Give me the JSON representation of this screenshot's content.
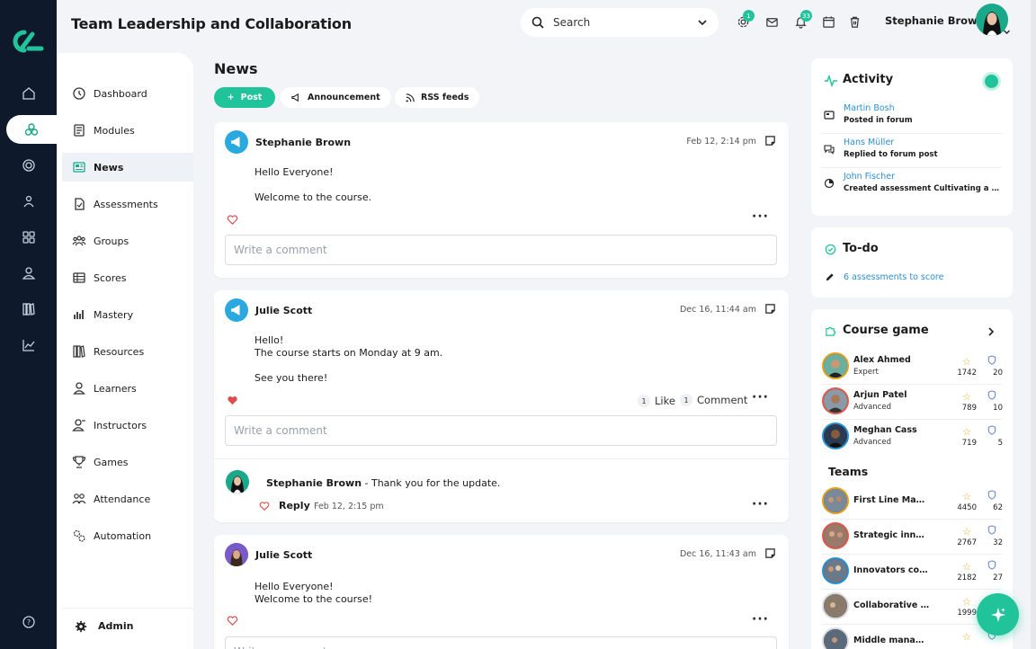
{
  "header": {
    "title": "Team Leadership and Collaboration",
    "search_placeholder": "Search",
    "settings_badge": "1",
    "notifications_badge": "33",
    "user_name": "Stephanie Brown"
  },
  "sidebar": {
    "items": [
      {
        "label": "Dashboard",
        "icon": "dashboard-icon"
      },
      {
        "label": "Modules",
        "icon": "modules-icon"
      },
      {
        "label": "News",
        "icon": "news-icon",
        "active": true
      },
      {
        "label": "Assessments",
        "icon": "assessments-icon"
      },
      {
        "label": "Groups",
        "icon": "groups-icon"
      },
      {
        "label": "Scores",
        "icon": "scores-icon"
      },
      {
        "label": "Mastery",
        "icon": "mastery-icon"
      },
      {
        "label": "Resources",
        "icon": "resources-icon"
      },
      {
        "label": "Learners",
        "icon": "learners-icon"
      },
      {
        "label": "Instructors",
        "icon": "instructors-icon"
      },
      {
        "label": "Games",
        "icon": "games-icon"
      },
      {
        "label": "Attendance",
        "icon": "attendance-icon"
      },
      {
        "label": "Automation",
        "icon": "automation-icon"
      }
    ],
    "admin_label": "Admin"
  },
  "news": {
    "title": "News",
    "actions": {
      "post": "Post",
      "announcement": "Announcement",
      "rss": "RSS feeds"
    },
    "comment_placeholder": "Write a comment",
    "posts": [
      {
        "author": "Stephanie Brown",
        "date": "Feb 12, 2:14 pm",
        "line1": "Hello Everyone!",
        "line2": "Welcome to the course."
      },
      {
        "author": "Julie Scott",
        "date": "Dec 16, 11:44 am",
        "line1": "Hello!",
        "line2": "The course starts on Monday at 9 am.",
        "line3": "See you there!",
        "like_count": "1",
        "like_label": "Like",
        "comment_count": "1",
        "comment_label": "Comment",
        "reply": {
          "author": "Stephanie Brown",
          "text": " - Thank you for the update.",
          "reply_label": "Reply",
          "date": "Feb 12, 2:15 pm"
        }
      },
      {
        "author": "Julie Scott",
        "date": "Dec 16, 11:43 am",
        "line1": "Hello Everyone!",
        "line2": "Welcome to the course!"
      }
    ]
  },
  "activity": {
    "title": "Activity",
    "items": [
      {
        "name": "Martin Bosh",
        "desc": "Posted in forum"
      },
      {
        "name": "Hans Müller",
        "desc": "Replied to forum post"
      },
      {
        "name": "John Fischer",
        "desc": "Created assessment Cultivating a positive team culture"
      }
    ]
  },
  "todo": {
    "title": "To-do",
    "item": "6 assessments to score"
  },
  "game": {
    "title": "Course game",
    "players": [
      {
        "name": "Alex Ahmed",
        "level": "Expert",
        "points": "1742",
        "badges": "20"
      },
      {
        "name": "Arjun Patel",
        "level": "Advanced",
        "points": "789",
        "badges": "10"
      },
      {
        "name": "Meghan Cass",
        "level": "Advanced",
        "points": "719",
        "badges": "5"
      }
    ],
    "teams_title": "Teams",
    "teams": [
      {
        "name": "First Line Managers",
        "points": "4450",
        "badges": "62"
      },
      {
        "name": "Strategic innovators",
        "points": "2767",
        "badges": "32"
      },
      {
        "name": "Innovators collective",
        "points": "2182",
        "badges": "27"
      },
      {
        "name": "Collaborative leaders",
        "points": "1999",
        "badges": ""
      },
      {
        "name": "Middle managers",
        "points": "",
        "badges": ""
      }
    ]
  },
  "colors": {
    "accent": "#21c49a",
    "rail": "#0e1a2b",
    "link": "#2a8fd0"
  }
}
